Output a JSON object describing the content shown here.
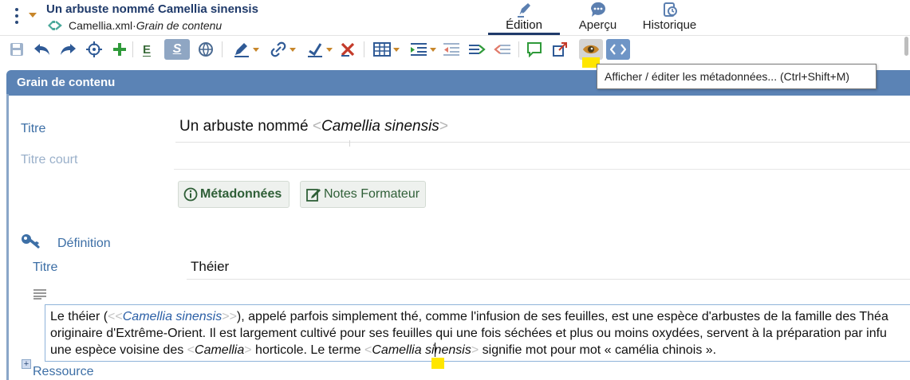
{
  "header": {
    "doc_title": "Un arbuste nommé Camellia sinensis",
    "file_name": "Camellia.xml",
    "separator": " · ",
    "doc_type": "Grain de contenu",
    "views": [
      {
        "label": "Édition",
        "icon": "pen-nib-icon",
        "active": true
      },
      {
        "label": "Aperçu",
        "icon": "chat-bubble-icon",
        "active": false
      },
      {
        "label": "Historique",
        "icon": "history-icon",
        "active": false
      }
    ]
  },
  "toolbar": {
    "items": [
      "save-icon",
      "undo-icon",
      "redo-icon",
      "target-icon",
      "add-icon",
      "bold-e-icon",
      "italic-s-icon",
      "globe-icon",
      "pen-icon",
      "link-icon",
      "check-icon",
      "cross-icon",
      "table-icon",
      "indent-icon",
      "outdent-icon",
      "move-right-icon",
      "move-left-icon",
      "comment-icon",
      "external-link-icon",
      "eye-metadata-icon",
      "code-icon"
    ],
    "letter_e": "E",
    "letter_s": "S",
    "tooltip": "Afficher / éditer les métadonnées... (Ctrl+Shift+M)",
    "colors": {
      "accent": "#5b83b5",
      "highlight": "#ffe600",
      "green": "#3a8a3a"
    }
  },
  "section": {
    "title": "Grain de contenu"
  },
  "form": {
    "titre_label": "Titre",
    "titre_prefix": "Un arbuste nommé ",
    "titre_tag_open": "<",
    "titre_italic": "Camellia sinensis",
    "titre_tag_close": ">",
    "titre_court_label": "Titre court",
    "btn_metadata": "Métadonnées",
    "btn_notes": "Notes Formateur"
  },
  "definition": {
    "title": "Définition",
    "field_label": "Titre",
    "field_value": "Théier",
    "para": {
      "l1_a": "Le théier (",
      "l1_open": "<<",
      "l1_term": "Camellia sinensis",
      "l1_close": ">>",
      "l1_b": "), appelé parfois simplement thé, comme l'infusion de ses feuilles, est une espèce d'arbustes de la famille des Théa",
      "l2": "originaire d'Extrême-Orient. Il est largement cultivé pour ses feuilles qui une fois séchées et plus ou moins oxydées, servent à la préparation par infu",
      "l3_a": "une espèce voisine des ",
      "l3_open1": "<",
      "l3_it1": "Camellia",
      "l3_close1": ">",
      "l3_b": " horticole. Le terme ",
      "l3_open2": "<",
      "l3_it2a": "Camellia ",
      "l3_it2b": "sinensis",
      "l3_close2": ">",
      "l3_c": " signifie mot pour mot « camélia chinois »."
    }
  },
  "resource": {
    "plus": "+",
    "label": "Ressource"
  }
}
